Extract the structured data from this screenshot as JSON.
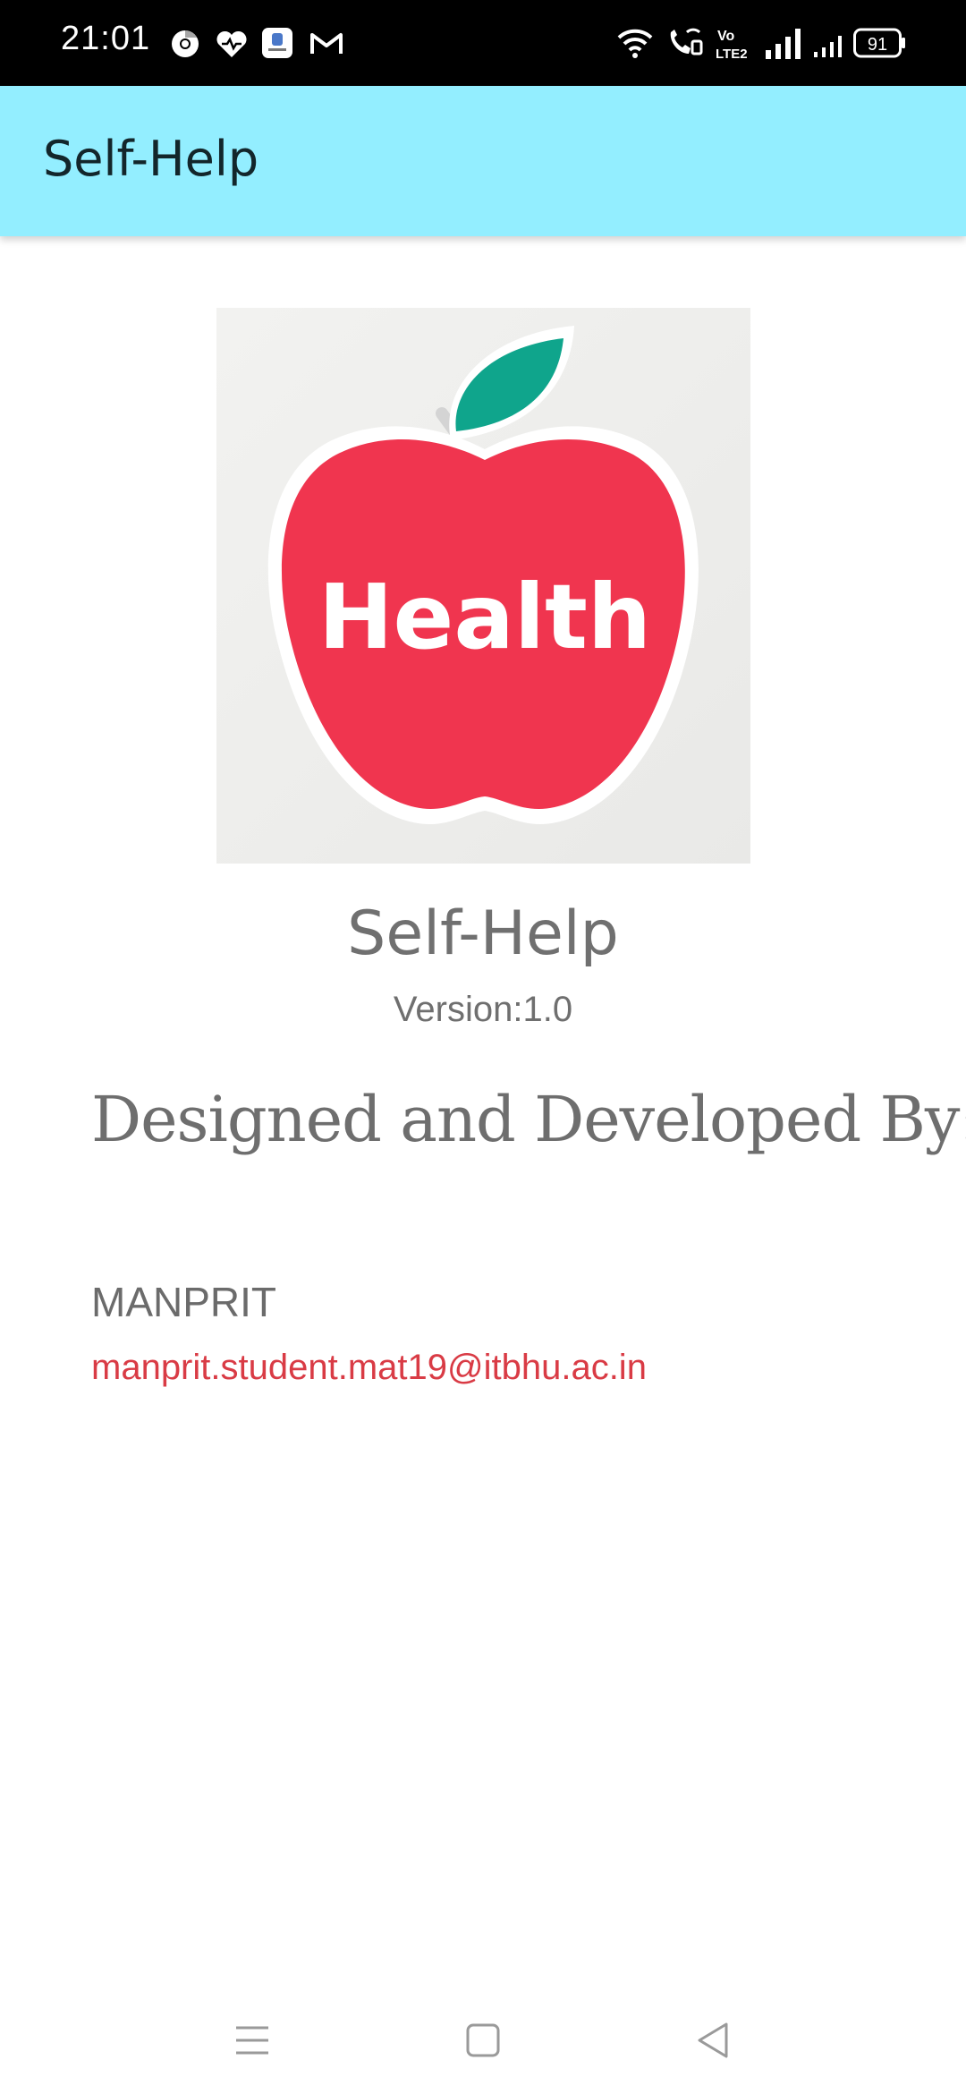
{
  "status_bar": {
    "time": "21:01",
    "battery": "91",
    "notification_icons": [
      "chrome-icon",
      "heart-icon",
      "app-icon",
      "gmail-icon"
    ],
    "system_icons": [
      "wifi-icon",
      "wifi-calling-icon",
      "volte-icon",
      "signal-icon",
      "signal-2-icon",
      "battery-icon"
    ]
  },
  "app_bar": {
    "title": "Self-Help"
  },
  "about": {
    "logo_text": "Health",
    "app_name": "Self-Help",
    "version": "Version:1.0",
    "credits_heading": "Designed and Developed By:",
    "developer_name": "MANPRIT",
    "developer_email": "manprit.student.mat19@itbhu.ac.in"
  },
  "colors": {
    "app_bar": "#93EEFF",
    "email": "#d93b45",
    "apple": "#f0354f",
    "leaf": "#0fa58c"
  },
  "nav_bar": {
    "icons": [
      "menu-icon",
      "home-icon",
      "back-icon"
    ]
  }
}
